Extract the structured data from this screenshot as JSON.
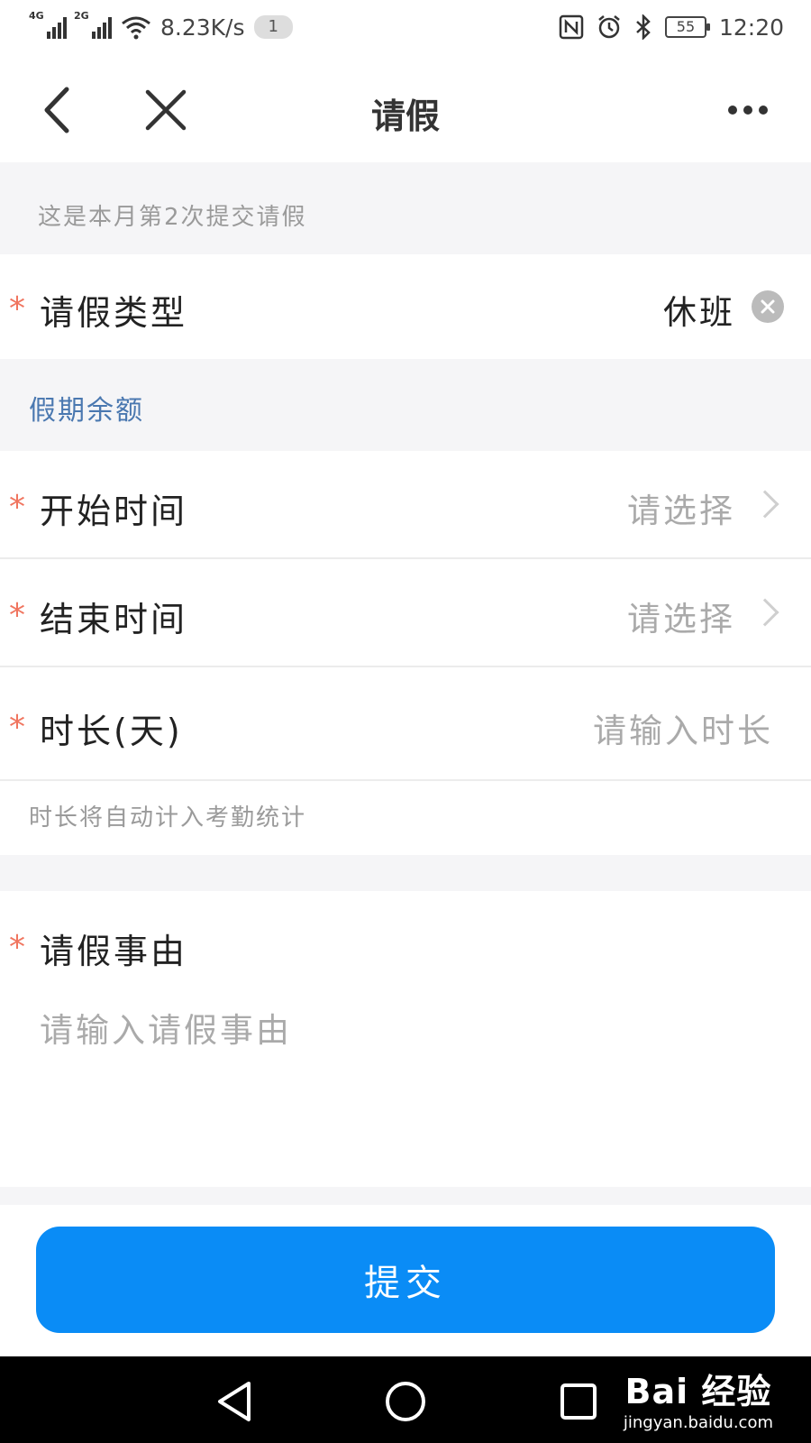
{
  "status_bar": {
    "net1": "4G",
    "net2": "2G",
    "speed": "8.23K/s",
    "badge": "1",
    "battery": "55",
    "time": "12:20"
  },
  "nav": {
    "title": "请假"
  },
  "info": {
    "submit_count_note": "这是本月第2次提交请假"
  },
  "leave_type": {
    "required_mark": "*",
    "label": "请假类型",
    "value": "休班"
  },
  "balance_link": {
    "label": "假期余额",
    "color": "#4a78b0"
  },
  "start_time": {
    "required_mark": "*",
    "label": "开始时间",
    "placeholder": "请选择"
  },
  "end_time": {
    "required_mark": "*",
    "label": "结束时间",
    "placeholder": "请选择"
  },
  "duration": {
    "required_mark": "*",
    "label": "时长(天)",
    "placeholder": "请输入时长",
    "hint": "时长将自动计入考勤统计"
  },
  "reason": {
    "required_mark": "*",
    "label": "请假事由",
    "placeholder": "请输入请假事由"
  },
  "submit": {
    "label": "提交",
    "color": "#0a8cf6"
  },
  "watermark": {
    "logo": "Bai  经验",
    "url": "jingyan.baidu.com"
  }
}
